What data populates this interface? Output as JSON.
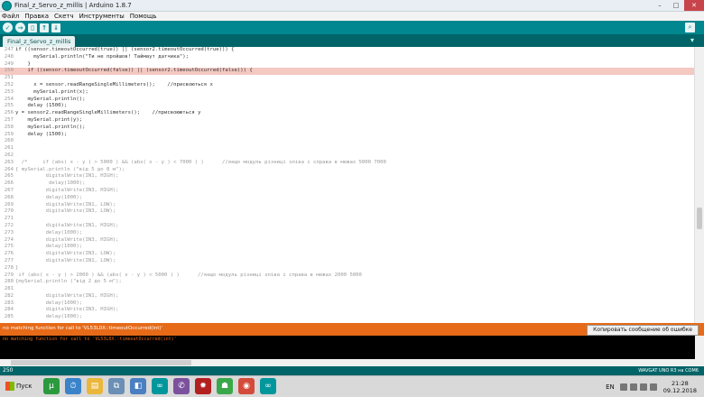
{
  "window": {
    "title": "Final_z_Servo_z_millis | Arduino 1.8.7"
  },
  "menu": [
    "Файл",
    "Правка",
    "Скетч",
    "Инструменты",
    "Помощь"
  ],
  "toolbar": {
    "verify": "✓",
    "upload": "→",
    "new": "▯",
    "open": "↑",
    "save": "↓",
    "serial": "⌕"
  },
  "tab": {
    "label": "Final_z_Servo_z_millis",
    "menu": "▾"
  },
  "code": [
    {
      "n": "247",
      "t": "if ((sensor.timeoutOccurred(true)) || (sensor2.timeoutOccurred(true))) {"
    },
    {
      "n": "248",
      "t": "      mySerial.println(\"Ти не пройшов! Таймаут датчика\");"
    },
    {
      "n": "249",
      "t": "    }"
    },
    {
      "n": "250",
      "t": "    if ((sensor.timeoutOccurred(false)) || (sensor2.timeoutOccurred(false))) {",
      "hl": true
    },
    {
      "n": "251",
      "t": ""
    },
    {
      "n": "252",
      "t": "      x = sensor.readRangeSingleMillimeters();    //присвоються x"
    },
    {
      "n": "253",
      "t": "      mySerial.print(x);"
    },
    {
      "n": "254",
      "t": "    mySerial.println();"
    },
    {
      "n": "255",
      "t": "    delay (1500);"
    },
    {
      "n": "256",
      "t": "y = sensor2.readRangeSingleMillimeters();    //присвоюються y"
    },
    {
      "n": "257",
      "t": "    mySerial.print(y);"
    },
    {
      "n": "258",
      "t": "    mySerial.println();"
    },
    {
      "n": "259",
      "t": "    delay (1500);"
    },
    {
      "n": "260",
      "t": ""
    },
    {
      "n": "261",
      "t": ""
    },
    {
      "n": "262",
      "t": ""
    },
    {
      "n": "263",
      "t": "  /*     if (abs( x - y ) > 5000 ) && (abs( x - y ) < 7000 ) )      //якщо модуль різниці зліва і справа в межах 5000 7000",
      "g": true
    },
    {
      "n": "264",
      "t": "{ mySerial.println (\"від 5 до 8 м\");",
      "g": true
    },
    {
      "n": "265",
      "t": "          digitalWrite(IN1, HIGH);",
      "g": true
    },
    {
      "n": "266",
      "t": "           delay(1000);",
      "g": true
    },
    {
      "n": "267",
      "t": "          digitalWrite(IN3, HIGH);",
      "g": true
    },
    {
      "n": "268",
      "t": "          delay(1000);",
      "g": true
    },
    {
      "n": "269",
      "t": "          digitalWrite(IN1, LOW);",
      "g": true
    },
    {
      "n": "270",
      "t": "          digitalWrite(IN3, LOW);",
      "g": true
    },
    {
      "n": "271",
      "t": "",
      "g": true
    },
    {
      "n": "272",
      "t": "          digitalWrite(IN1, HIGH);",
      "g": true
    },
    {
      "n": "273",
      "t": "          delay(1000);",
      "g": true
    },
    {
      "n": "274",
      "t": "          digitalWrite(IN3, HIGH);",
      "g": true
    },
    {
      "n": "275",
      "t": "          delay(1000);",
      "g": true
    },
    {
      "n": "276",
      "t": "          digitalWrite(IN3, LOW);",
      "g": true
    },
    {
      "n": "277",
      "t": "          digitalWrite(IN1, LOW);",
      "g": true
    },
    {
      "n": "278",
      "t": "}",
      "g": true
    },
    {
      "n": "279",
      "t": " if (abs( x - y ) > 2000 ) && (abs( x - y ) < 5000 ) )      //якщо модуль різниці зліва і справа в межах 2000 5000",
      "g": true
    },
    {
      "n": "280",
      "t": "{mySerial.println (\"від 2 до 5 м\");",
      "g": true
    },
    {
      "n": "281",
      "t": "",
      "g": true
    },
    {
      "n": "282",
      "t": "          digitalWrite(IN1, HIGH);",
      "g": true
    },
    {
      "n": "283",
      "t": "          delay(1000);",
      "g": true
    },
    {
      "n": "284",
      "t": "          digitalWrite(IN3, HIGH);",
      "g": true
    },
    {
      "n": "285",
      "t": "          delay(1000);",
      "g": true
    }
  ],
  "error": {
    "message": "no matching function for call to 'VL53L0X::timeoutOccurred(int)'",
    "copy_button": "Копировать сообщение об ошибке",
    "console": "no matching function for call to 'VL53L0X::timeoutOccurred(int)'"
  },
  "status": {
    "line": "250",
    "board": "WAVGAT UNO R3 на COM6"
  },
  "taskbar": {
    "start": "Пуск",
    "lang": "EN",
    "time": "21:28",
    "date": "09.12.2018",
    "apps": [
      {
        "name": "utorrent-icon",
        "color": "#2b9a3e",
        "glyph": "µ"
      },
      {
        "name": "clock-icon",
        "color": "#3a83c8",
        "glyph": "⏱"
      },
      {
        "name": "folder-icon",
        "color": "#e9b73b",
        "glyph": "▤"
      },
      {
        "name": "network-icon",
        "color": "#6b8fb5",
        "glyph": "⧉"
      },
      {
        "name": "tools-icon",
        "color": "#4a7fc1",
        "glyph": "◧"
      },
      {
        "name": "arduino-icon",
        "color": "#00979c",
        "glyph": "∞"
      },
      {
        "name": "viber-icon",
        "color": "#7b519d",
        "glyph": "✆"
      },
      {
        "name": "bug-icon",
        "color": "#b32020",
        "glyph": "✹"
      },
      {
        "name": "android-icon",
        "color": "#3aa84a",
        "glyph": "☗"
      },
      {
        "name": "chrome-icon",
        "color": "#d34c3b",
        "glyph": "◉"
      },
      {
        "name": "arduino2-icon",
        "color": "#00979c",
        "glyph": "∞"
      }
    ]
  }
}
